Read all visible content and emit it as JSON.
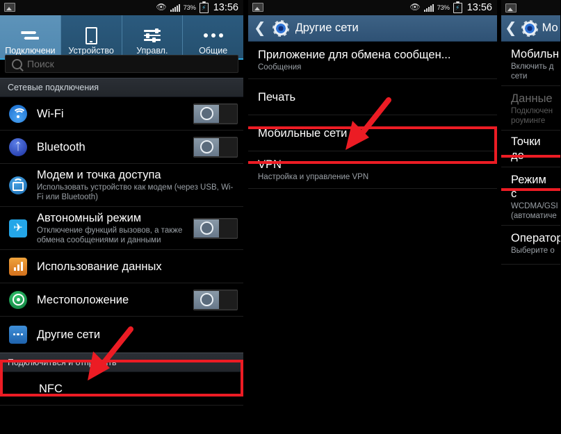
{
  "statusbar": {
    "image_icon": "image-icon",
    "eye_icon": "eye-icon",
    "signal_icon": "signal-bars-icon",
    "battery_percent": "73%",
    "battery_icon": "battery-charging-icon",
    "time": "13:56"
  },
  "colors": {
    "accent_blue": "#2fa8e0",
    "actionbar_blue": "#3d6285",
    "highlight_red": "#ec1c24",
    "tab_active": "#5d93b9"
  },
  "panel1": {
    "tabs": [
      {
        "label": "Подключени",
        "icon": "connections-arrows-icon",
        "active": true
      },
      {
        "label": "Устройство",
        "icon": "device-phone-icon",
        "active": false
      },
      {
        "label": "Управл.",
        "icon": "sliders-controls-icon",
        "active": false
      },
      {
        "label": "Общие",
        "icon": "more-dots-icon",
        "active": false
      }
    ],
    "search": {
      "placeholder": "Поиск",
      "icon": "search-icon"
    },
    "sections": [
      {
        "title": "Сетевые подключения"
      },
      {
        "title": "Подключиться и отправить"
      }
    ],
    "items": [
      {
        "title": "Wi-Fi",
        "sub": "",
        "icon": "wifi-icon",
        "toggle": "off"
      },
      {
        "title": "Bluetooth",
        "sub": "",
        "icon": "bluetooth-icon",
        "toggle": "off"
      },
      {
        "title": "Модем и точка доступа",
        "sub": "Использовать устройство как модем (через USB, Wi-Fi или Bluetooth)",
        "icon": "tethering-hotspot-icon",
        "toggle": "none"
      },
      {
        "title": "Автономный режим",
        "sub": "Отключение функций вызовов, а также обмена сообщениями и данными",
        "icon": "airplane-mode-icon",
        "toggle": "off"
      },
      {
        "title": "Использование данных",
        "sub": "",
        "icon": "data-usage-icon",
        "toggle": "none"
      },
      {
        "title": "Местоположение",
        "sub": "",
        "icon": "location-icon",
        "toggle": "off"
      },
      {
        "title": "Другие сети",
        "sub": "",
        "icon": "other-networks-icon",
        "toggle": "none",
        "highlighted": true
      },
      {
        "title": "NFC",
        "sub": "",
        "icon": "nfc-icon",
        "toggle": "none"
      }
    ]
  },
  "panel2": {
    "actionbar": {
      "back_icon": "back-chevron-icon",
      "app_icon": "settings-gear-icon",
      "title": "Другие сети"
    },
    "items": [
      {
        "title": "Приложение для обмена сообщен...",
        "sub": "Сообщения"
      },
      {
        "title": "Печать",
        "sub": ""
      },
      {
        "title": "Мобильные сети",
        "sub": "",
        "highlighted": true
      },
      {
        "title": "VPN",
        "sub": "Настройка и управление VPN"
      }
    ]
  },
  "panel3": {
    "actionbar": {
      "back_icon": "back-chevron-icon",
      "app_icon": "settings-gear-icon",
      "title": "Мо"
    },
    "items": [
      {
        "title": "Мобильн",
        "sub": "Включить д сети",
        "dim": false
      },
      {
        "title": "Данные",
        "sub": "Подключен роуминге",
        "dim": true
      },
      {
        "title": "Точки до",
        "sub": "",
        "highlighted": true
      },
      {
        "title": "Режим с",
        "sub": "WCDMA/GSI (автоматиче"
      },
      {
        "title": "Оператор",
        "sub": "Выберите о"
      }
    ]
  }
}
